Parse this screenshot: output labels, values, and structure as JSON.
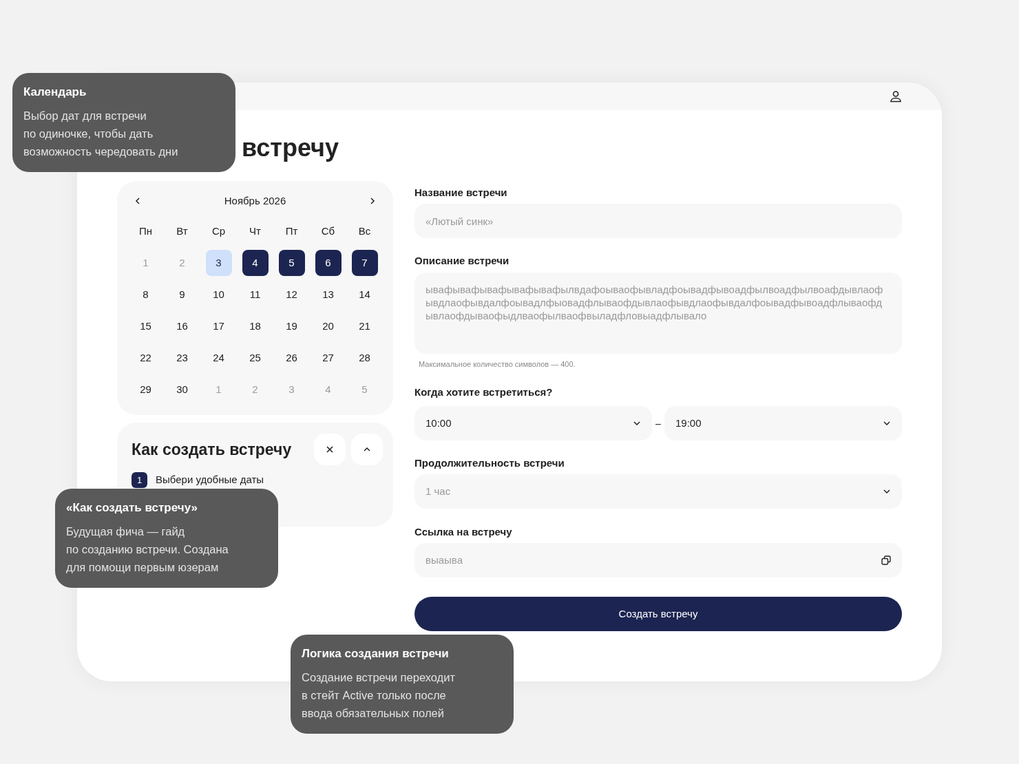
{
  "title": "встречу",
  "calendar": {
    "month": "Ноябрь 2026",
    "weekdays": [
      "Пн",
      "Вт",
      "Ср",
      "Чт",
      "Пт",
      "Сб",
      "Вс"
    ],
    "days": [
      {
        "label": "1",
        "disabled": true,
        "today": false,
        "selected": false
      },
      {
        "label": "2",
        "disabled": true,
        "today": false,
        "selected": false
      },
      {
        "label": "3",
        "disabled": false,
        "today": true,
        "selected": false
      },
      {
        "label": "4",
        "disabled": false,
        "today": false,
        "selected": true
      },
      {
        "label": "5",
        "disabled": false,
        "today": false,
        "selected": true
      },
      {
        "label": "6",
        "disabled": false,
        "today": false,
        "selected": true
      },
      {
        "label": "7",
        "disabled": false,
        "today": false,
        "selected": true
      },
      {
        "label": "8",
        "disabled": false,
        "today": false,
        "selected": false
      },
      {
        "label": "9",
        "disabled": false,
        "today": false,
        "selected": false
      },
      {
        "label": "10",
        "disabled": false,
        "today": false,
        "selected": false
      },
      {
        "label": "11",
        "disabled": false,
        "today": false,
        "selected": false
      },
      {
        "label": "12",
        "disabled": false,
        "today": false,
        "selected": false
      },
      {
        "label": "13",
        "disabled": false,
        "today": false,
        "selected": false
      },
      {
        "label": "14",
        "disabled": false,
        "today": false,
        "selected": false
      },
      {
        "label": "15",
        "disabled": false,
        "today": false,
        "selected": false
      },
      {
        "label": "16",
        "disabled": false,
        "today": false,
        "selected": false
      },
      {
        "label": "17",
        "disabled": false,
        "today": false,
        "selected": false
      },
      {
        "label": "18",
        "disabled": false,
        "today": false,
        "selected": false
      },
      {
        "label": "19",
        "disabled": false,
        "today": false,
        "selected": false
      },
      {
        "label": "20",
        "disabled": false,
        "today": false,
        "selected": false
      },
      {
        "label": "21",
        "disabled": false,
        "today": false,
        "selected": false
      },
      {
        "label": "22",
        "disabled": false,
        "today": false,
        "selected": false
      },
      {
        "label": "23",
        "disabled": false,
        "today": false,
        "selected": false
      },
      {
        "label": "24",
        "disabled": false,
        "today": false,
        "selected": false
      },
      {
        "label": "25",
        "disabled": false,
        "today": false,
        "selected": false
      },
      {
        "label": "26",
        "disabled": false,
        "today": false,
        "selected": false
      },
      {
        "label": "27",
        "disabled": false,
        "today": false,
        "selected": false
      },
      {
        "label": "28",
        "disabled": false,
        "today": false,
        "selected": false
      },
      {
        "label": "29",
        "disabled": false,
        "today": false,
        "selected": false
      },
      {
        "label": "30",
        "disabled": false,
        "today": false,
        "selected": false
      },
      {
        "label": "1",
        "disabled": true,
        "today": false,
        "selected": false
      },
      {
        "label": "2",
        "disabled": true,
        "today": false,
        "selected": false
      },
      {
        "label": "3",
        "disabled": true,
        "today": false,
        "selected": false
      },
      {
        "label": "4",
        "disabled": true,
        "today": false,
        "selected": false
      },
      {
        "label": "5",
        "disabled": true,
        "today": false,
        "selected": false
      }
    ]
  },
  "guide": {
    "title": "Как создать встречу",
    "steps": [
      {
        "number": "1",
        "text": "Выбери удобные даты"
      }
    ]
  },
  "form": [
    {
      "kind": "text",
      "label": "Название встречи",
      "placeholder": "«Лютый синк»"
    },
    {
      "kind": "textarea",
      "label": "Описание встречи",
      "value": "ывафывафывафывафывафылвдафоываофывладфоывадфывоадфылвоадфылвоафдывлаоф ывдлаофывдалфоывадлфыовадфлываофдывлаофывдлаофывдалфоывадфывоадфлываофд ывлаофдываофыдлваофылваофвыладфловыадфлывало",
      "hint": "Максимальное количество символов — 400."
    },
    {
      "kind": "time_range",
      "label": "Когда хотите встретиться?",
      "from": "10:00",
      "separator": "–",
      "to": "19:00"
    },
    {
      "kind": "select",
      "label": "Продолжительность встречи",
      "placeholder": "1 час"
    },
    {
      "kind": "link",
      "label": "Ссылка на встречу",
      "value": "выаыва"
    }
  ],
  "submit": "Создать встречу",
  "annotations": [
    {
      "title": "Календарь",
      "text": "Выбор дат для встречи\nпо одиночке, чтобы дать\nвозможность чередовать дни"
    },
    {
      "title": "«Как создать встречу»",
      "text": "Будущая фича — гайд\nпо созданию встречи. Создана\nдля помощи первым юзерам"
    },
    {
      "title": "Логика создания встречи",
      "text": "Создание встречи переходит\nв стейт Active только после\nввода обязательных полей"
    }
  ]
}
